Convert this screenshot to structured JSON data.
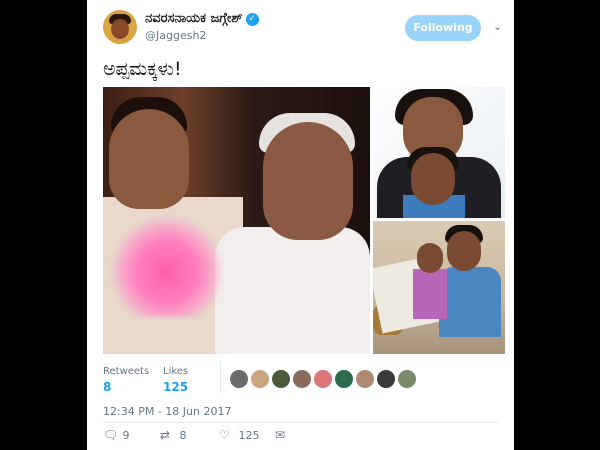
{
  "author": {
    "display_name": "ನವರಸನಾಯಕ ಜಗ್ಗೇಶ್",
    "handle": "@Jaggesh2",
    "verified": true
  },
  "follow_button": {
    "label": "Following"
  },
  "tweet": {
    "text": "ಅಪ್ಪಮಕ್ಕಳು!"
  },
  "stats": {
    "retweets_label": "Retweets",
    "retweets_count": "8",
    "likes_label": "Likes",
    "likes_count": "125"
  },
  "likers": [
    "#6b6b6b",
    "#c9a680",
    "#4a5a3a",
    "#8a6a5a",
    "#d77",
    "#2b6b4b",
    "#b08a70",
    "#3a3a3a",
    "#7a8a6a"
  ],
  "timestamp": "12:34 PM - 18 Jun 2017",
  "actions": {
    "reply_count": "9",
    "retweet_count": "8",
    "like_count": "125"
  },
  "colors": {
    "accent": "#1da1f2",
    "following_button": "#99d3f7",
    "heart_overlay": "#ff5fa8"
  },
  "icons": [
    "verified-badge-icon",
    "chevron-down-icon",
    "reply-icon",
    "retweet-icon",
    "like-icon",
    "message-icon"
  ]
}
